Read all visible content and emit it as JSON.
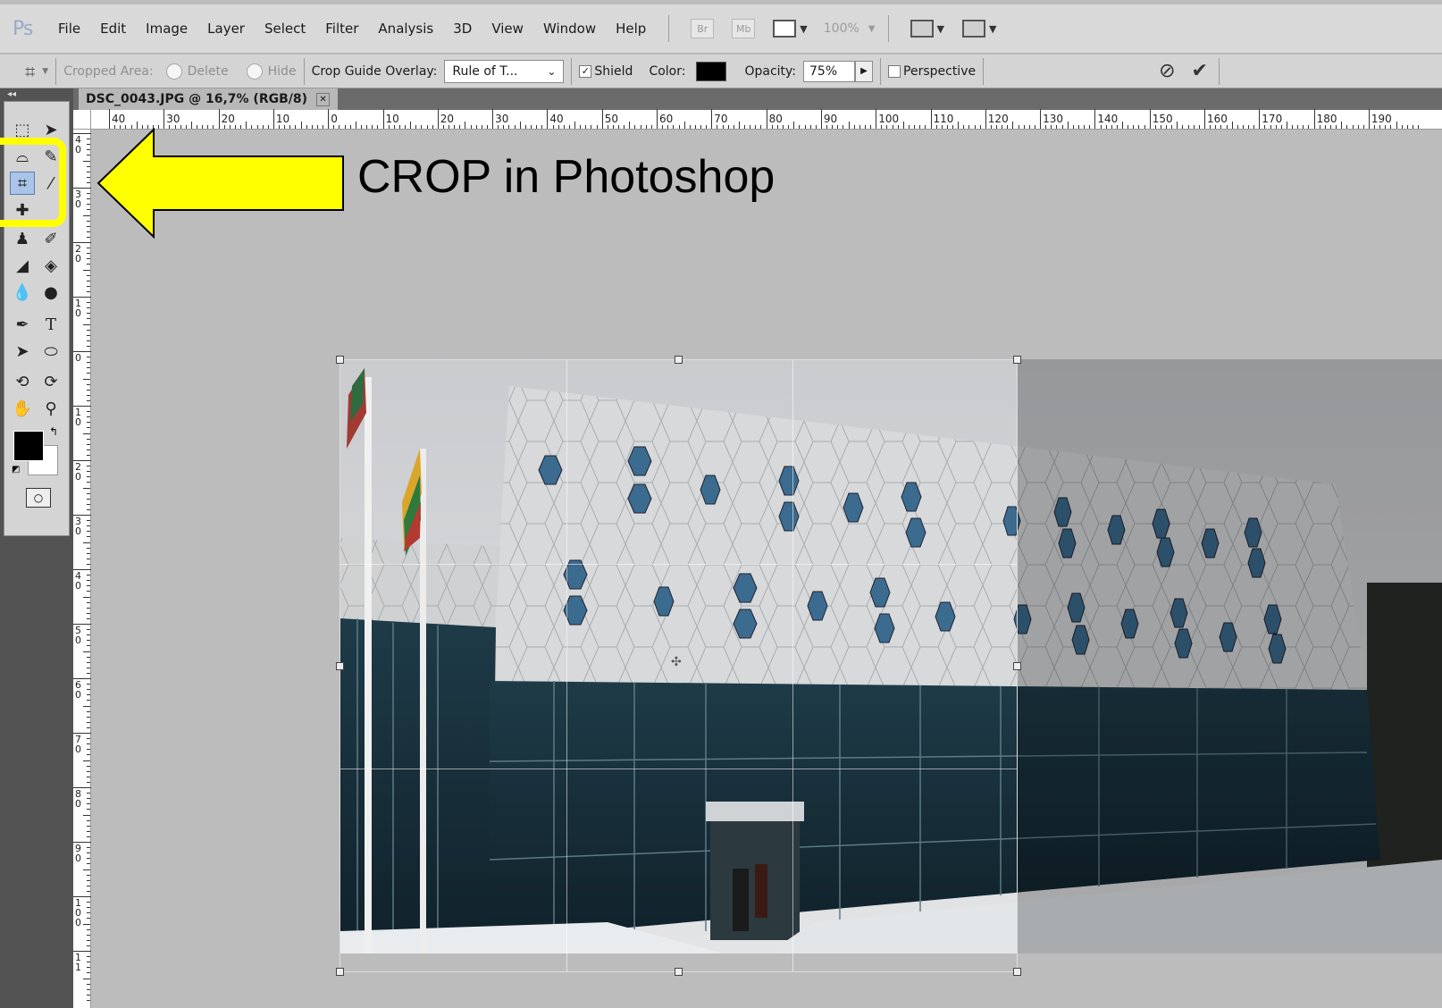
{
  "app": {
    "logo": "Ps"
  },
  "menubar": {
    "items": [
      "File",
      "Edit",
      "Image",
      "Layer",
      "Select",
      "Filter",
      "Analysis",
      "3D",
      "View",
      "Window",
      "Help"
    ],
    "bridge_label": "Br",
    "minibridge_label": "Mb",
    "zoom_level": "100%"
  },
  "options": {
    "cropped_area_label": "Cropped Area:",
    "delete_label": "Delete",
    "hide_label": "Hide",
    "overlay_label": "Crop Guide Overlay:",
    "overlay_value": "Rule of T...",
    "shield_label": "Shield",
    "shield_checked": true,
    "color_label": "Color:",
    "shield_color": "#000000",
    "opacity_label": "Opacity:",
    "opacity_value": "75%",
    "perspective_label": "Perspective",
    "perspective_checked": false
  },
  "document": {
    "tab_title": "DSC_0043.JPG @ 16,7% (RGB/8)"
  },
  "ruler": {
    "top_labels": [
      "40",
      "30",
      "20",
      "10",
      "0",
      "10",
      "20",
      "30",
      "40",
      "50",
      "60",
      "70",
      "80",
      "90",
      "100",
      "110",
      "120",
      "130",
      "140",
      "150",
      "160",
      "170",
      "180",
      "190"
    ],
    "left_labels": [
      "4 0",
      "3 0",
      "2 0",
      "1 0",
      "0",
      "1 0",
      "2 0",
      "3 0",
      "4 0",
      "5 0",
      "6 0",
      "7 0",
      "8 0",
      "9 0",
      "1 0 0",
      "1 1"
    ]
  },
  "annotation": {
    "title": "CROP in Photoshop",
    "arrow_color": "#ffff00",
    "highlight_color": "#ffff00"
  }
}
